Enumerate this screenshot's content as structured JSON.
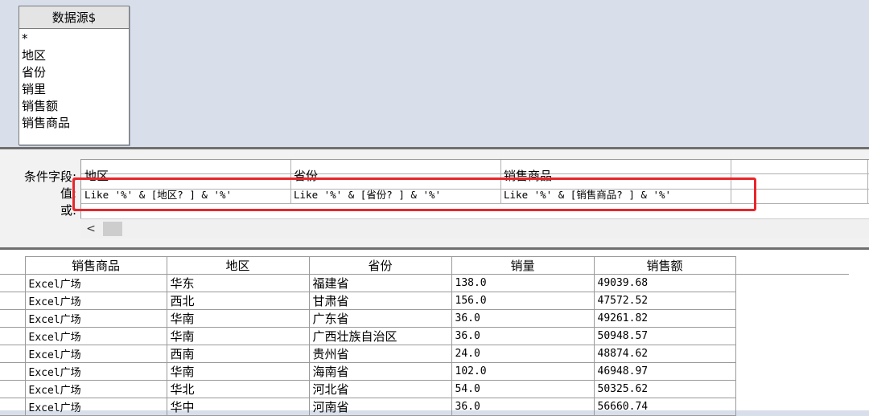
{
  "table_box": {
    "title": "数据源$",
    "fields": [
      "*",
      "地区",
      "省份",
      "销里",
      "销售额",
      "销售商品"
    ]
  },
  "design_grid": {
    "row_labels": [
      "条件字段:",
      "值:",
      "或:"
    ],
    "fields": [
      "地区",
      "省份",
      "销售商品",
      ""
    ],
    "criteria": [
      "Like '%' & [地区? ] & '%'",
      "Like '%' & [省份? ] & '%'",
      "Like '%' & [销售商品? ] & '%'",
      ""
    ],
    "scroll_left_glyph": "<"
  },
  "results": {
    "columns": [
      "销售商品",
      "地区",
      "省份",
      "销量",
      "销售额"
    ],
    "rows": [
      [
        "Excel广场",
        "华东",
        "福建省",
        "138.0",
        "49039.68"
      ],
      [
        "Excel广场",
        "西北",
        "甘肃省",
        "156.0",
        "47572.52"
      ],
      [
        "Excel广场",
        "华南",
        "广东省",
        "36.0",
        "49261.82"
      ],
      [
        "Excel广场",
        "华南",
        "广西壮族自治区",
        "36.0",
        "50948.57"
      ],
      [
        "Excel广场",
        "西南",
        "贵州省",
        "24.0",
        "48874.62"
      ],
      [
        "Excel广场",
        "华南",
        "海南省",
        "102.0",
        "46948.97"
      ],
      [
        "Excel广场",
        "华北",
        "河北省",
        "54.0",
        "50325.62"
      ],
      [
        "Excel广场",
        "华中",
        "河南省",
        "36.0",
        "56660.74"
      ]
    ]
  },
  "colors": {
    "highlight": "#e8262b",
    "pane_bg": "#d8dfeb"
  }
}
